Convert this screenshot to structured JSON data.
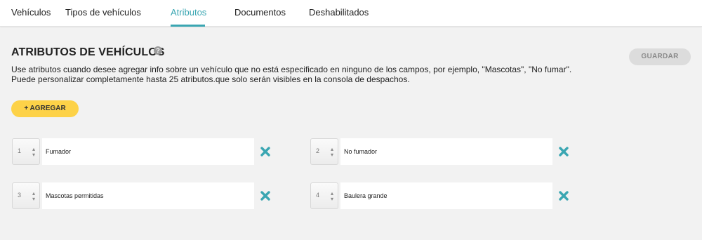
{
  "tabs": [
    {
      "label": "Vehículos"
    },
    {
      "label": "Tipos de vehículos"
    },
    {
      "label": "Atributos"
    },
    {
      "label": "Documentos"
    },
    {
      "label": "Deshabilitados"
    }
  ],
  "active_tab": "Atributos",
  "page": {
    "title": "ATRIBUTOS DE VEHÍCULOS",
    "help_icon": "question-circle-icon",
    "description": "Use atributos cuando desee agregar info sobre un vehículo que no está especificado en ninguno de los campos, por ejemplo, \"Mascotas\", \"No fumar\". Puede personalizar completamente hasta 25 atributos.que solo serán visibles en la consola de despachos."
  },
  "buttons": {
    "save_label": "GUARDAR",
    "add_label": "+ AGREGAR"
  },
  "attributes": [
    {
      "order": "1",
      "name": "Fumador"
    },
    {
      "order": "2",
      "name": "No fumador"
    },
    {
      "order": "3",
      "name": "Mascotas permitidas"
    },
    {
      "order": "4",
      "name": "Baulera grande"
    }
  ],
  "colors": {
    "accent": "#3aa6b2",
    "add_button": "#fdd248",
    "remove_icon": "#3aa6b2"
  },
  "icons": {
    "remove": "close-x-icon",
    "stepper": "up-down-arrows-icon"
  }
}
